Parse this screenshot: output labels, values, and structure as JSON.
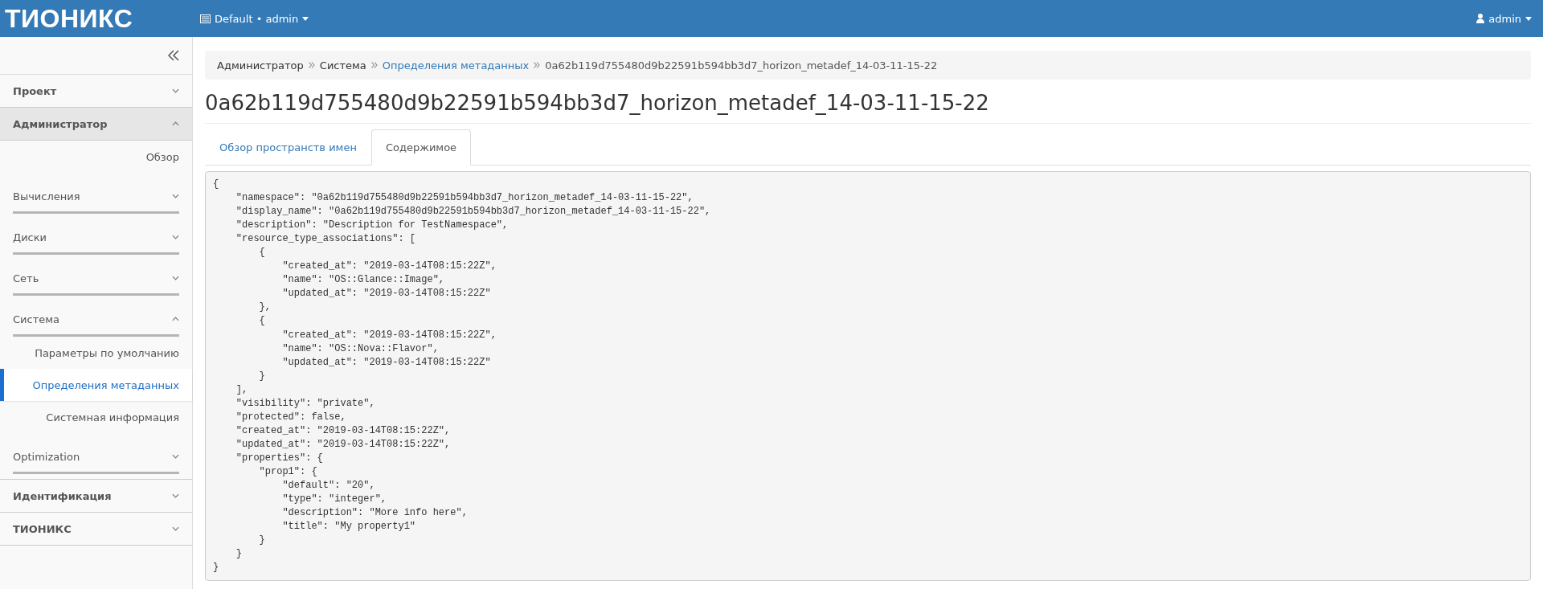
{
  "header": {
    "logo": "ТИОНИКС",
    "project_menu": "Default • admin",
    "user_menu": "admin"
  },
  "sidebar": {
    "panels": [
      {
        "label": "Проект",
        "expanded": false
      },
      {
        "label": "Администратор",
        "expanded": true,
        "children": [
          {
            "kind": "link",
            "label": "Обзор",
            "selected": false
          },
          {
            "kind": "group",
            "label": "Вычисления",
            "expanded": false
          },
          {
            "kind": "group",
            "label": "Диски",
            "expanded": false
          },
          {
            "kind": "group",
            "label": "Сеть",
            "expanded": false
          },
          {
            "kind": "group",
            "label": "Система",
            "expanded": true,
            "children": [
              {
                "label": "Параметры по умолчанию",
                "selected": false
              },
              {
                "label": "Определения метаданных",
                "selected": true
              },
              {
                "label": "Системная информация",
                "selected": false
              }
            ]
          },
          {
            "kind": "group",
            "label": "Optimization",
            "expanded": false
          }
        ]
      },
      {
        "label": "Идентификация",
        "expanded": false
      },
      {
        "label": "ТИОНИКС",
        "expanded": false
      }
    ]
  },
  "breadcrumb": [
    {
      "kind": "text",
      "label": "Администратор"
    },
    {
      "kind": "text",
      "label": "Система"
    },
    {
      "kind": "link",
      "label": "Определения метаданных"
    },
    {
      "kind": "current",
      "label": "0a62b119d755480d9b22591b594bb3d7_horizon_metadef_14-03-11-15-22"
    }
  ],
  "page_title": "0a62b119d755480d9b22591b594bb3d7_horizon_metadef_14-03-11-15-22",
  "tabs": [
    {
      "label": "Обзор пространств имен",
      "selected": false
    },
    {
      "label": "Содержимое",
      "selected": true
    }
  ],
  "content_lines": [
    "{",
    "    \"namespace\": \"0a62b119d755480d9b22591b594bb3d7_horizon_metadef_14-03-11-15-22\",",
    "    \"display_name\": \"0a62b119d755480d9b22591b594bb3d7_horizon_metadef_14-03-11-15-22\",",
    "    \"description\": \"Description for TestNamespace\",",
    "    \"resource_type_associations\": [",
    "        {",
    "            \"created_at\": \"2019-03-14T08:15:22Z\",",
    "            \"name\": \"OS::Glance::Image\",",
    "            \"updated_at\": \"2019-03-14T08:15:22Z\"",
    "        },",
    "        {",
    "            \"created_at\": \"2019-03-14T08:15:22Z\",",
    "            \"name\": \"OS::Nova::Flavor\",",
    "            \"updated_at\": \"2019-03-14T08:15:22Z\"",
    "        }",
    "    ],",
    "    \"visibility\": \"private\",",
    "    \"protected\": false,",
    "    \"created_at\": \"2019-03-14T08:15:22Z\",",
    "    \"updated_at\": \"2019-03-14T08:15:22Z\",",
    "    \"properties\": {",
    "        \"prop1\": {",
    "            \"default\": \"20\",",
    "            \"type\": \"integer\",",
    "            \"description\": \"More info here\",",
    "            \"title\": \"My property1\"",
    "        }",
    "    }",
    "}"
  ]
}
